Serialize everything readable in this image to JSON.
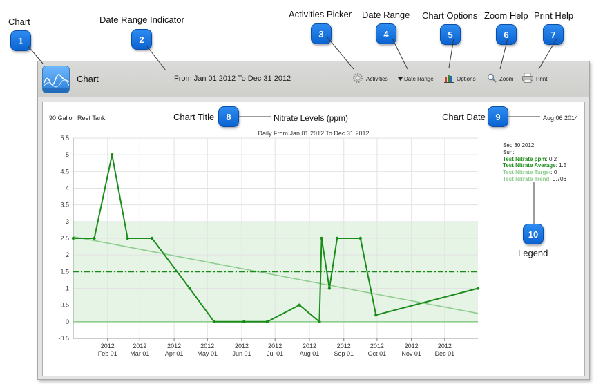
{
  "callouts": [
    {
      "number": "1",
      "label": "Chart"
    },
    {
      "number": "2",
      "label": "Date Range Indicator"
    },
    {
      "number": "3",
      "label": "Activities Picker"
    },
    {
      "number": "4",
      "label": "Date Range"
    },
    {
      "number": "5",
      "label": "Chart Options"
    },
    {
      "number": "6",
      "label": "Zoom Help"
    },
    {
      "number": "7",
      "label": "Print Help"
    },
    {
      "number": "8",
      "label": "Chart Title"
    },
    {
      "number": "9",
      "label": "Chart Date"
    },
    {
      "number": "10",
      "label": "Legend"
    }
  ],
  "toolbar": {
    "title": "Chart",
    "range_text": "From  Jan 01 2012  To  Dec 31 2012",
    "activities_label": "Activities",
    "date_range_label": "Date Range",
    "options_label": "Options",
    "zoom_label": "Zoom",
    "print_label": "Print",
    "icons": [
      "chart-app-icon",
      "gear-icon",
      "dropdown-arrow-icon",
      "bar-chart-icon",
      "magnifier-icon",
      "printer-icon"
    ]
  },
  "chart_header": {
    "tank_name": "90 Gallon Reef Tank",
    "title": "Nitrate Levels (ppm)",
    "date": "Aug 06 2014"
  },
  "legend": {
    "date": "Sep 30 2012",
    "day": "Sun:",
    "items": [
      {
        "name": "Test Nitrate ppm",
        "value": "0.2",
        "color": "#1a8c1a"
      },
      {
        "name": "Test Nitrate Average",
        "value": "1.5",
        "color": "#1a8c1a"
      },
      {
        "name": "Test Nitrate Target",
        "value": "0",
        "color": "#8fcc8f"
      },
      {
        "name": "Test Nitrate Trend",
        "value": "0.706",
        "color": "#8fcc8f"
      }
    ]
  },
  "chart_data": {
    "type": "line",
    "subtitle": "Daily  From  Jan 01 2012  To  Dec 31 2012",
    "xlabel": "",
    "ylabel": "",
    "xlim": [
      "2012-01-01",
      "2012-12-31"
    ],
    "ylim": [
      -0.5,
      5.5
    ],
    "y_ticks": [
      "5.5",
      "5",
      "4.5",
      "4",
      "3.5",
      "3",
      "2.5",
      "2",
      "1.5",
      "1",
      "0.5",
      "0",
      "-0.5"
    ],
    "x_ticks": [
      {
        "year": "2012",
        "label": "Feb 01",
        "date": "2012-02-01"
      },
      {
        "year": "2012",
        "label": "Mar 01",
        "date": "2012-03-01"
      },
      {
        "year": "2012",
        "label": "Apr 01",
        "date": "2012-04-01"
      },
      {
        "year": "2012",
        "label": "May 01",
        "date": "2012-05-01"
      },
      {
        "year": "2012",
        "label": "Jun 01",
        "date": "2012-06-01"
      },
      {
        "year": "2012",
        "label": "Jul 01",
        "date": "2012-07-01"
      },
      {
        "year": "2012",
        "label": "Aug 01",
        "date": "2012-08-01"
      },
      {
        "year": "2012",
        "label": "Sep 01",
        "date": "2012-09-01"
      },
      {
        "year": "2012",
        "label": "Oct 01",
        "date": "2012-10-01"
      },
      {
        "year": "2012",
        "label": "Nov 01",
        "date": "2012-11-01"
      },
      {
        "year": "2012",
        "label": "Dec 01",
        "date": "2012-12-01"
      }
    ],
    "grid": true,
    "target_band": [
      0,
      3
    ],
    "series": [
      {
        "name": "Test Nitrate ppm",
        "color": "#1a8c1a",
        "style": "solid-markers",
        "points": [
          [
            "2012-01-01",
            2.5
          ],
          [
            "2012-01-20",
            2.5
          ],
          [
            "2012-02-05",
            5.0
          ],
          [
            "2012-02-19",
            2.5
          ],
          [
            "2012-03-12",
            2.5
          ],
          [
            "2012-04-15",
            1.0
          ],
          [
            "2012-05-07",
            0.0
          ],
          [
            "2012-06-03",
            0.0
          ],
          [
            "2012-06-24",
            0.0
          ],
          [
            "2012-07-23",
            0.5
          ],
          [
            "2012-08-10",
            0.0
          ],
          [
            "2012-08-12",
            2.5
          ],
          [
            "2012-08-19",
            1.0
          ],
          [
            "2012-08-26",
            2.5
          ],
          [
            "2012-09-16",
            2.5
          ],
          [
            "2012-09-30",
            0.2
          ],
          [
            "2012-12-31",
            1.0
          ]
        ]
      },
      {
        "name": "Test Nitrate Average",
        "color": "#1a8c1a",
        "style": "dash-dot",
        "points": [
          [
            "2012-01-01",
            1.5
          ],
          [
            "2012-12-31",
            1.5
          ]
        ]
      },
      {
        "name": "Test Nitrate Target",
        "color": "#8fcc8f",
        "style": "solid",
        "points": [
          [
            "2012-01-01",
            0
          ],
          [
            "2012-12-31",
            0
          ]
        ]
      },
      {
        "name": "Test Nitrate Trend",
        "color": "#8fcc8f",
        "style": "solid",
        "points": [
          [
            "2012-01-01",
            2.55
          ],
          [
            "2012-12-31",
            0.25
          ]
        ]
      }
    ]
  }
}
